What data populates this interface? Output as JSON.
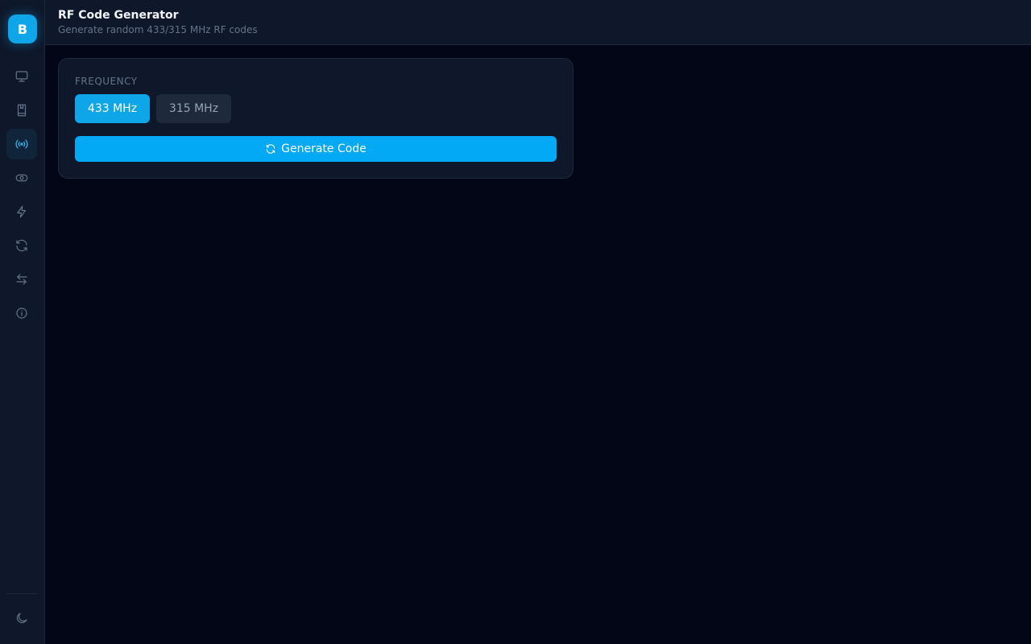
{
  "sidebar": {
    "logo_letter": "B",
    "items": [
      {
        "icon": "monitor-icon"
      },
      {
        "icon": "book-icon"
      },
      {
        "icon": "broadcast-icon",
        "active": true
      },
      {
        "icon": "toggle-icon"
      },
      {
        "icon": "lightning-icon"
      },
      {
        "icon": "refresh-icon"
      },
      {
        "icon": "arrows-left-right-icon"
      },
      {
        "icon": "info-icon"
      }
    ],
    "footer_icon": "moon-icon"
  },
  "header": {
    "title": "RF Code Generator",
    "subtitle": "Generate random 433/315 MHz RF codes"
  },
  "card": {
    "frequency_label": "FREQUENCY",
    "frequencies": [
      {
        "label": "433 MHz",
        "selected": true
      },
      {
        "label": "315 MHz",
        "selected": false
      }
    ],
    "generate_label": "Generate Code"
  },
  "colors": {
    "accent": "#0ea5e9",
    "background": "#020617",
    "panel": "#0f172a"
  }
}
